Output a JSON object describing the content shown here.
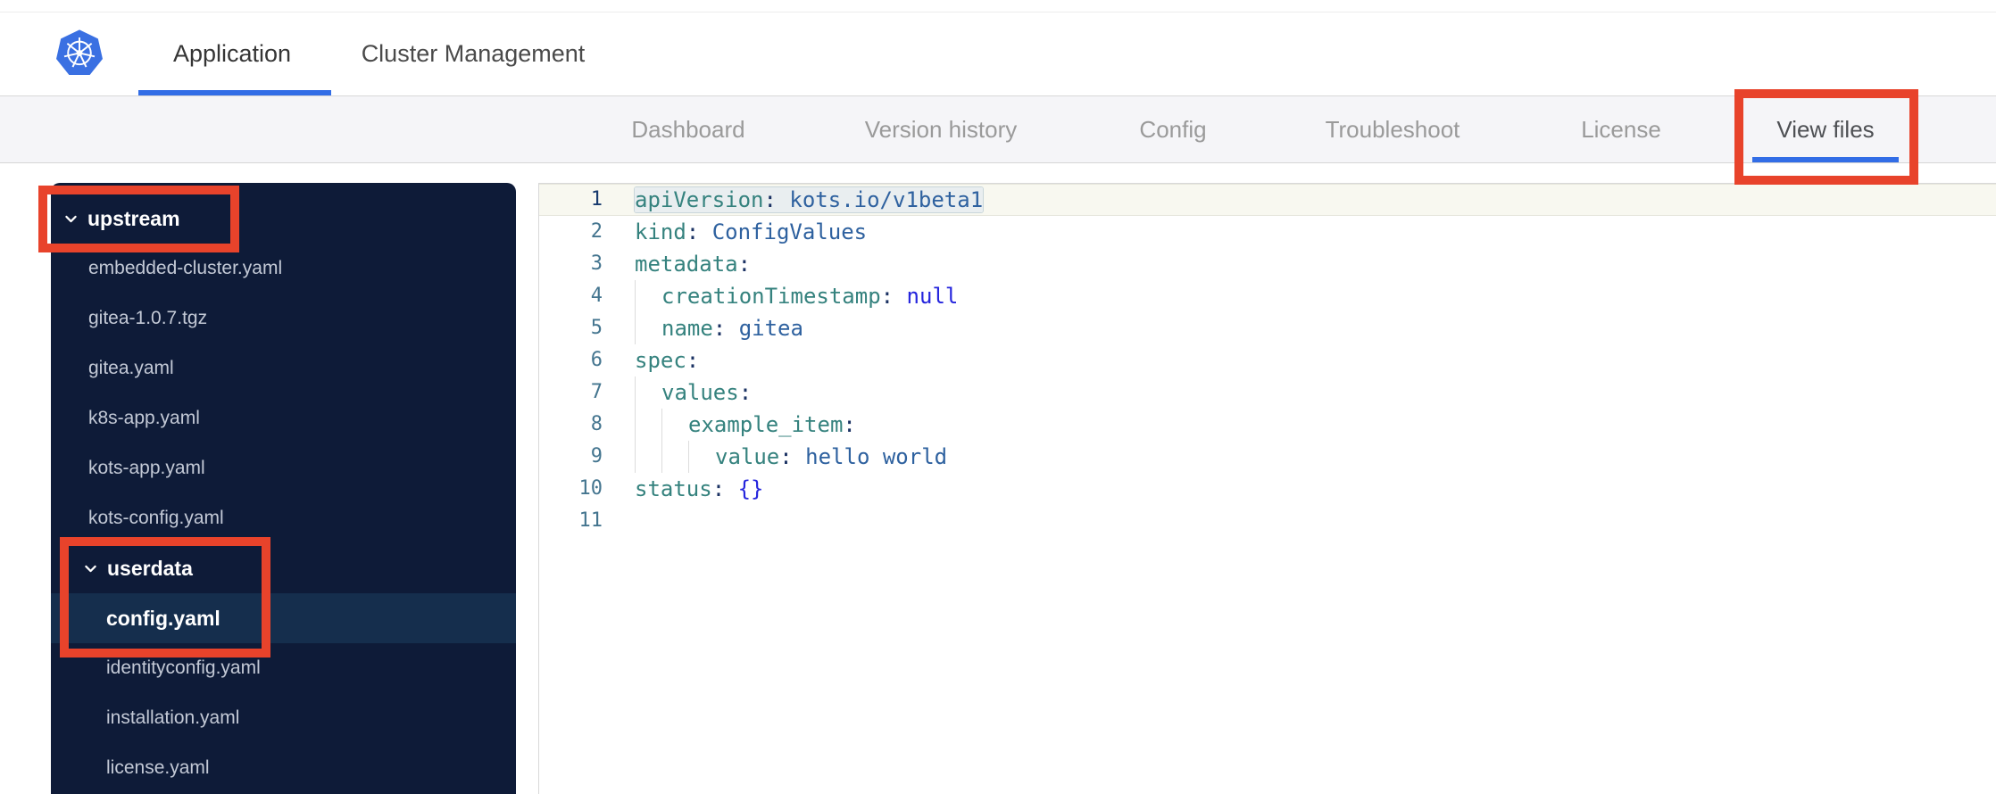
{
  "header": {
    "logo_icon": "kubernetes-logo",
    "tabs": [
      {
        "label": "Application",
        "active": true
      },
      {
        "label": "Cluster Management",
        "active": false
      }
    ]
  },
  "subnav": {
    "tabs": [
      {
        "label": "Dashboard",
        "active": false
      },
      {
        "label": "Version history",
        "active": false
      },
      {
        "label": "Config",
        "active": false
      },
      {
        "label": "Troubleshoot",
        "active": false
      },
      {
        "label": "License",
        "active": false
      },
      {
        "label": "View files",
        "active": true,
        "annotated": true
      }
    ]
  },
  "file_tree": {
    "items": [
      {
        "type": "dir",
        "label": "upstream",
        "level": 0,
        "expanded": true,
        "annotated": true
      },
      {
        "type": "file",
        "label": "embedded-cluster.yaml",
        "level": 1
      },
      {
        "type": "file",
        "label": "gitea-1.0.7.tgz",
        "level": 1
      },
      {
        "type": "file",
        "label": "gitea.yaml",
        "level": 1
      },
      {
        "type": "file",
        "label": "k8s-app.yaml",
        "level": 1
      },
      {
        "type": "file",
        "label": "kots-app.yaml",
        "level": 1
      },
      {
        "type": "file",
        "label": "kots-config.yaml",
        "level": 1
      },
      {
        "type": "dir",
        "label": "userdata",
        "level": 1,
        "expanded": true,
        "annotated": true
      },
      {
        "type": "file",
        "label": "config.yaml",
        "level": 2,
        "selected": true,
        "annotated": true
      },
      {
        "type": "file",
        "label": "identityconfig.yaml",
        "level": 2
      },
      {
        "type": "file",
        "label": "installation.yaml",
        "level": 2
      },
      {
        "type": "file",
        "label": "license.yaml",
        "level": 2
      }
    ]
  },
  "code_viewer": {
    "active_line": 1,
    "lines": [
      {
        "n": 1,
        "indent": 0,
        "selected": true,
        "tokens": [
          {
            "t": "key",
            "s": "apiVersion"
          },
          {
            "t": "punc",
            "s": ": "
          },
          {
            "t": "value",
            "s": "kots.io/v1beta1"
          }
        ]
      },
      {
        "n": 2,
        "indent": 0,
        "tokens": [
          {
            "t": "key",
            "s": "kind"
          },
          {
            "t": "punc",
            "s": ": "
          },
          {
            "t": "value",
            "s": "ConfigValues"
          }
        ]
      },
      {
        "n": 3,
        "indent": 0,
        "tokens": [
          {
            "t": "key",
            "s": "metadata"
          },
          {
            "t": "punc",
            "s": ":"
          }
        ]
      },
      {
        "n": 4,
        "indent": 1,
        "tokens": [
          {
            "t": "key",
            "s": "creationTimestamp"
          },
          {
            "t": "punc",
            "s": ": "
          },
          {
            "t": "keyword",
            "s": "null"
          }
        ]
      },
      {
        "n": 5,
        "indent": 1,
        "tokens": [
          {
            "t": "key",
            "s": "name"
          },
          {
            "t": "punc",
            "s": ": "
          },
          {
            "t": "value",
            "s": "gitea"
          }
        ]
      },
      {
        "n": 6,
        "indent": 0,
        "tokens": [
          {
            "t": "key",
            "s": "spec"
          },
          {
            "t": "punc",
            "s": ":"
          }
        ]
      },
      {
        "n": 7,
        "indent": 1,
        "tokens": [
          {
            "t": "key",
            "s": "values"
          },
          {
            "t": "punc",
            "s": ":"
          }
        ]
      },
      {
        "n": 8,
        "indent": 2,
        "tokens": [
          {
            "t": "key",
            "s": "example_item"
          },
          {
            "t": "punc",
            "s": ":"
          }
        ]
      },
      {
        "n": 9,
        "indent": 3,
        "tokens": [
          {
            "t": "key",
            "s": "value"
          },
          {
            "t": "punc",
            "s": ": "
          },
          {
            "t": "value",
            "s": "hello world"
          }
        ]
      },
      {
        "n": 10,
        "indent": 0,
        "tokens": [
          {
            "t": "key",
            "s": "status"
          },
          {
            "t": "punc",
            "s": ": "
          },
          {
            "t": "keyword",
            "s": "{}"
          }
        ]
      },
      {
        "n": 11,
        "indent": 0,
        "tokens": []
      }
    ]
  },
  "annotations": {
    "color": "#e8432b",
    "targets": [
      "upstream",
      "userdata + config.yaml",
      "View files"
    ]
  },
  "colors": {
    "accent_blue": "#326de6",
    "sidebar_bg": "#0e1b38",
    "sidebar_selected": "#152e4d",
    "annotation_red": "#e8432b",
    "kubernetes_blue": "#3a70e2"
  }
}
